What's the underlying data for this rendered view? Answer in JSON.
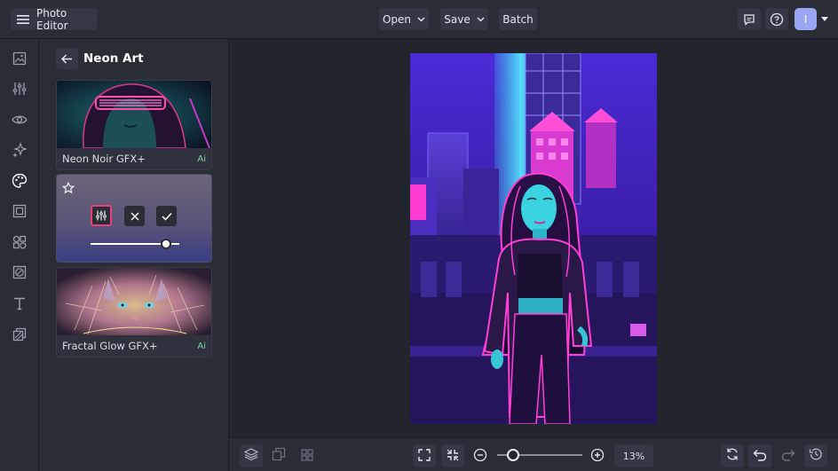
{
  "header": {
    "app_title": "Photo Editor",
    "menu_open": "Open",
    "menu_save": "Save",
    "menu_batch": "Batch",
    "avatar_initial": "I"
  },
  "panel": {
    "title": "Neon Art",
    "effects": [
      {
        "label": "Neon Noir GFX+",
        "badge": "Ai"
      },
      {
        "label": "Fractal Glow GFX+",
        "badge": "Ai"
      }
    ],
    "active_effect": {
      "intensity": 0.9
    }
  },
  "zoom": {
    "label": "13%",
    "value": 0.13
  },
  "colors": {
    "accent": "#e8407a",
    "canvas_bg": "#23252e",
    "panel_bg": "#2a2c36"
  }
}
